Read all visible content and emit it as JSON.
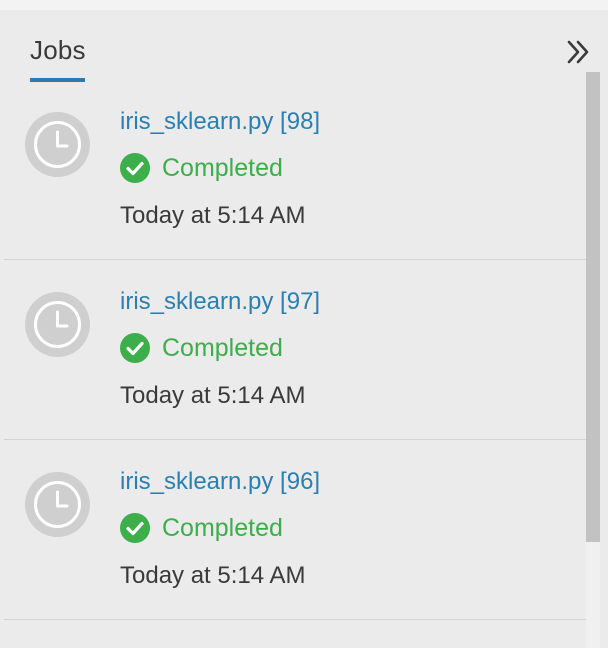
{
  "panel": {
    "tab_label": "Jobs",
    "collapse_icon": "double-chevron-right-icon",
    "accent_color": "#2b7ab0"
  },
  "jobs": [
    {
      "title": "iris_sklearn.py [98]",
      "status": "Completed",
      "time": "Today at 5:14 AM"
    },
    {
      "title": "iris_sklearn.py [97]",
      "status": "Completed",
      "time": "Today at 5:14 AM"
    },
    {
      "title": "iris_sklearn.py [96]",
      "status": "Completed",
      "time": "Today at 5:14 AM"
    }
  ],
  "colors": {
    "link": "#2a7fb2",
    "success": "#3cae4a",
    "avatar_bg": "#cfcfcf"
  },
  "icons": {
    "job_avatar": "clock-icon",
    "status": "check-circle-icon"
  }
}
